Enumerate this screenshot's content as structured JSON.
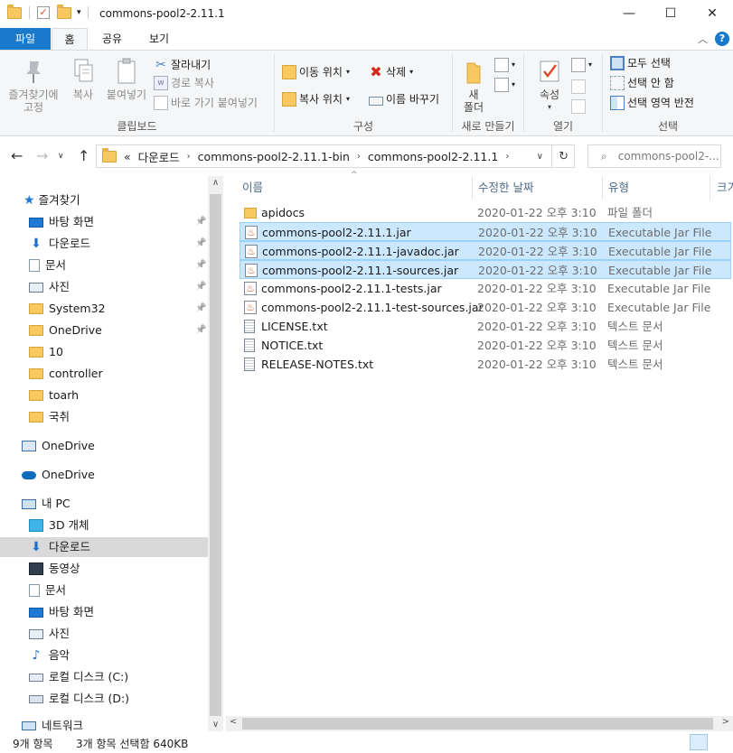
{
  "window": {
    "title": "commons-pool2-2.11.1",
    "minimize": "—",
    "maximize": "☐",
    "close": "✕"
  },
  "ribbon_tabs": [
    "파일",
    "홈",
    "공유",
    "보기"
  ],
  "ribbon": {
    "clipboard": {
      "pin_quick_access": "즐겨찾기에\n고정",
      "copy": "복사",
      "paste": "붙여넣기",
      "cut": "잘라내기",
      "copy_path": "경로 복사",
      "paste_shortcut": "바로 가기 붙여넣기",
      "group_label": "클립보드"
    },
    "organize": {
      "move_to": "이동 위치",
      "copy_to": "복사 위치",
      "delete": "삭제",
      "rename": "이름 바꾸기",
      "group_label": "구성"
    },
    "new": {
      "new_folder": "새\n폴더",
      "group_label": "새로 만들기"
    },
    "open": {
      "properties": "속성",
      "group_label": "열기"
    },
    "select": {
      "select_all": "모두 선택",
      "select_none": "선택 안 함",
      "invert_selection": "선택 영역 반전",
      "group_label": "선택"
    }
  },
  "address": {
    "overflow": "«",
    "crumbs": [
      "다운로드",
      "commons-pool2-2.11.1-bin",
      "commons-pool2-2.11.1"
    ],
    "search_placeholder": "commons-pool2-..."
  },
  "nav": {
    "quick_access": "즐겨찾기",
    "pinned": [
      {
        "label": "바탕 화면",
        "icon": "desktop-icon"
      },
      {
        "label": "다운로드",
        "icon": "download-icon"
      },
      {
        "label": "문서",
        "icon": "documents-icon"
      },
      {
        "label": "사진",
        "icon": "pictures-icon"
      },
      {
        "label": "System32",
        "icon": "folder-icon"
      },
      {
        "label": "OneDrive",
        "icon": "folder-icon"
      }
    ],
    "recent": [
      "10",
      "controller",
      "toarh",
      "국취"
    ],
    "onedrive1": "OneDrive",
    "onedrive2": "OneDrive",
    "this_pc": "내 PC",
    "pc_items": [
      {
        "label": "3D 개체",
        "icon": "3d-objects-icon"
      },
      {
        "label": "다운로드",
        "icon": "download-icon"
      },
      {
        "label": "동영상",
        "icon": "videos-icon"
      },
      {
        "label": "문서",
        "icon": "documents-icon"
      },
      {
        "label": "바탕 화면",
        "icon": "desktop-icon"
      },
      {
        "label": "사진",
        "icon": "pictures-icon"
      },
      {
        "label": "음악",
        "icon": "music-icon"
      },
      {
        "label": "로컬 디스크 (C:)",
        "icon": "drive-c-icon"
      },
      {
        "label": "로컬 디스크 (D:)",
        "icon": "drive-d-icon"
      }
    ],
    "network": "네트워크"
  },
  "columns": {
    "name": "이름",
    "modified": "수정한 날짜",
    "type": "유형",
    "size": "크기"
  },
  "files": [
    {
      "name": "apidocs",
      "date": "2020-01-22 오후 3:10",
      "type": "파일 폴더",
      "kind": "folder",
      "selected": false
    },
    {
      "name": "commons-pool2-2.11.1.jar",
      "date": "2020-01-22 오후 3:10",
      "type": "Executable Jar File",
      "kind": "jar",
      "selected": true
    },
    {
      "name": "commons-pool2-2.11.1-javadoc.jar",
      "date": "2020-01-22 오후 3:10",
      "type": "Executable Jar File",
      "kind": "jar",
      "selected": true
    },
    {
      "name": "commons-pool2-2.11.1-sources.jar",
      "date": "2020-01-22 오후 3:10",
      "type": "Executable Jar File",
      "kind": "jar",
      "selected": true
    },
    {
      "name": "commons-pool2-2.11.1-tests.jar",
      "date": "2020-01-22 오후 3:10",
      "type": "Executable Jar File",
      "kind": "jar",
      "selected": false
    },
    {
      "name": "commons-pool2-2.11.1-test-sources.jar",
      "date": "2020-01-22 오후 3:10",
      "type": "Executable Jar File",
      "kind": "jar",
      "selected": false
    },
    {
      "name": "LICENSE.txt",
      "date": "2020-01-22 오후 3:10",
      "type": "텍스트 문서",
      "kind": "txt",
      "selected": false
    },
    {
      "name": "NOTICE.txt",
      "date": "2020-01-22 오후 3:10",
      "type": "텍스트 문서",
      "kind": "txt",
      "selected": false
    },
    {
      "name": "RELEASE-NOTES.txt",
      "date": "2020-01-22 오후 3:10",
      "type": "텍스트 문서",
      "kind": "txt",
      "selected": false
    }
  ],
  "status": {
    "item_count": "9개 항목",
    "selected": "3개 항목 선택함 640KB"
  },
  "colors": {
    "accent": "#1979ca",
    "selection_bg": "#cce8ff",
    "selection_border": "#99d1ff",
    "folder": "#f6c85f"
  }
}
